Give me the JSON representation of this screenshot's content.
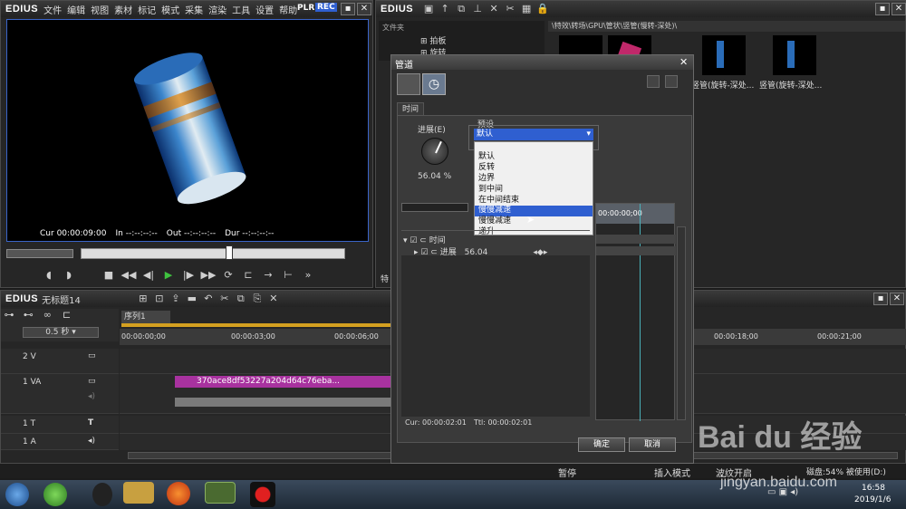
{
  "app": {
    "brand": "EDIUS"
  },
  "player": {
    "menu": [
      "文件",
      "编辑",
      "视图",
      "素材",
      "标记",
      "模式",
      "采集",
      "渲染",
      "工具",
      "设置",
      "帮助"
    ],
    "plr": "PLR",
    "rec": "REC",
    "cur_label": "Cur",
    "cur_value": "00:00:09:00",
    "in_label": "In",
    "in_value": "--:--:--:--",
    "out_label": "Out",
    "out_value": "--:--:--:--",
    "dur_label": "Dur",
    "dur_value": "--:--:--:--"
  },
  "bin": {
    "folder_label": "文件夹",
    "tree": [
      "拍板",
      "旋转"
    ],
    "path": "\\特效\\转场\\GPU\\管状\\竖管(慢转-深处)\\",
    "thumbs": [
      "竖管(旋转-深处...",
      "竖管(旋转-深处..."
    ]
  },
  "timeline": {
    "project": "无标题14",
    "sequence_tab": "序列1",
    "zoom": "0.5 秒",
    "ruler": [
      "00:00:00;00",
      "00:00:03;00",
      "00:00:06;00",
      "00:00:18;00",
      "00:00:21;00"
    ],
    "tracks": [
      {
        "name": "2 V"
      },
      {
        "name": "1 VA"
      },
      {
        "name": "1 T"
      },
      {
        "name": "1 A"
      }
    ],
    "clip_name": "370ace8df53227a204d64c76eba..."
  },
  "status": {
    "pause": "暂停",
    "insert_mode": "插入模式",
    "ripple": "波纹开启",
    "disk": "磁盘:54% 被使用(D:)"
  },
  "dialog": {
    "title": "管道",
    "tab_time": "时间",
    "progress_label": "进展(E)",
    "progress_value": "56.04 %",
    "preset_label": "预设",
    "preset_selected": "默认",
    "options": [
      "默认",
      "反转",
      "边界",
      "到中间",
      "在中间结束",
      "慢慢减速",
      "慢慢减速",
      "递升"
    ],
    "highlighted_index": 5,
    "tree_time": "时间",
    "tree_progress": "进展",
    "tree_progress_value": "56.04",
    "kf_time": "00:00:00;00",
    "cur_text": "Cur: 00:00:02:01",
    "ttl_text": "Ttl: 00:00:02:01",
    "ok": "确定",
    "cancel": "取消",
    "side_label": "特"
  },
  "taskbar": {
    "time": "16:58",
    "date": "2019/1/6"
  },
  "watermark": {
    "logo": "Bai du 经验",
    "url": "jingyan.baidu.com"
  },
  "colors": {
    "accent_blue": "#3a64c8",
    "clip_magenta": "#a8329f",
    "highlight": "#2f5fd0",
    "play_green": "#3fc23f"
  }
}
